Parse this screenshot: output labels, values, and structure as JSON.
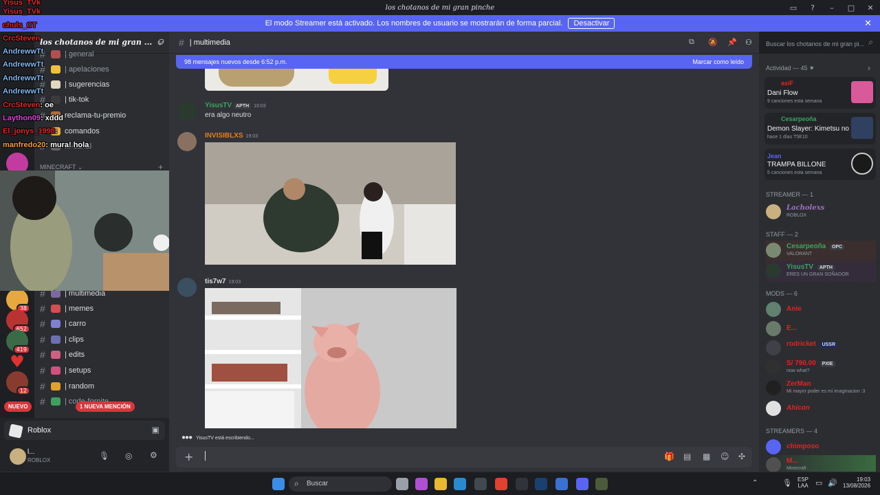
{
  "window": {
    "title": "los chotanos de mi gran pinche"
  },
  "banner": {
    "text": "El modo Streamer está activado. Los nombres de usuario se mostrarán de forma parcial.",
    "button": "Desactivar"
  },
  "server": {
    "name": "los chotanos de mi gran ...",
    "channels_top": [
      "| general",
      "| apelaciones",
      "| sugerencias",
      "| tik-tok",
      "reclama-tu-premio",
      "comandos",
      "...-canal"
    ],
    "category": "MINECRAFT",
    "channels_bottom": [
      "| multimedia",
      "| memes",
      "| carro",
      "| clips",
      "| edits",
      "| setups",
      "| random",
      "| code-fornite"
    ]
  },
  "guild_badges": [
    "38",
    "652",
    "419",
    "12"
  ],
  "pills": {
    "new": "NUEVO",
    "mention": "1 NUEVA MENCIÓN"
  },
  "overlay_chat": [
    {
      "user": "Yisus_TVk",
      "msg": ""
    },
    {
      "user": "Yisus_TVk",
      "msg": ""
    },
    {
      "user": "chuls_CT",
      "msg": ""
    },
    {
      "user": "CrcSteven",
      "msg": ""
    },
    {
      "user": "AndrewwTt",
      "msg": ""
    },
    {
      "user": "AndrewwTt",
      "msg": ""
    },
    {
      "user": "AndrewwTt",
      "msg": ""
    },
    {
      "user": "AndrewwTt",
      "msg": ""
    },
    {
      "user": "CrcSteven",
      "msg": ": oe"
    },
    {
      "user": "Laython09",
      "msg": ": xddd"
    },
    {
      "user": "El_jonys_1998",
      "msg": ":"
    },
    {
      "user": "manfredo20",
      "msg": ": mura! hola"
    }
  ],
  "user_panel": {
    "activity": "Roblox",
    "name": "l...",
    "status": "ROBLOX"
  },
  "channel": {
    "name": "| multimedia",
    "search_placeholder": "Buscar los chotanos de mi gran pi..."
  },
  "new_messages": {
    "text": "98 mensajes nuevos desde 6:52 p.m.",
    "action": "Marcar como leído"
  },
  "messages": [
    {
      "user": "YisusTV",
      "tag": "APTH",
      "time": "19:03",
      "text": "era algo neutro"
    },
    {
      "user": "INVISIBLXS",
      "time": "19:03"
    },
    {
      "user": "tis7w7",
      "time": "19:03"
    }
  ],
  "typing": "YisusTV está escribiendo...",
  "members": {
    "activity_header": "Actividad — 45",
    "activity": [
      {
        "user": "asiF",
        "title": "Dani Flow",
        "sub": "9 canciones esta semana"
      },
      {
        "user": "Cesarpeoña",
        "title": "Demon Slayer: Kimetsu no ...",
        "sub": "hace 1 días   T5E10"
      },
      {
        "user": "Jean",
        "title": "TRAMPA BILLONE",
        "sub": "5 canciones esta semana"
      }
    ],
    "sections": [
      "STREAMER — 1",
      "STAFF — 2",
      "MODS — 6",
      "STREAMERS — 4"
    ],
    "streamer": [
      {
        "name": "Lacholexs",
        "status": "ROBLOX"
      }
    ],
    "staff": [
      {
        "name": "Cesarpeoña",
        "tag": "OPC",
        "status": "VALORANT"
      },
      {
        "name": "YisusTV",
        "tag": "APTH",
        "status": "ERES UN GRAN SOÑADOR"
      }
    ],
    "mods": [
      {
        "name": "Anie",
        "status": ""
      },
      {
        "name": "E...",
        "status": ""
      },
      {
        "name": "rodricket",
        "tag": "USSR",
        "status": ""
      },
      {
        "name": "S/ 790.00",
        "tag": "PXIE",
        "status": "now what?"
      },
      {
        "name": "ZerMan",
        "status": "Mi mayor poder es mi imaginacion :3"
      },
      {
        "name": "Ahicon",
        "status": ""
      }
    ],
    "streamers": [
      {
        "name": "chimposo",
        "status": ""
      },
      {
        "name": "M...",
        "status": "Minecraft"
      }
    ]
  },
  "taskbar": {
    "search": "Buscar",
    "lang": "ESP",
    "lang2": "LAA",
    "time": "19:03",
    "date": "13/08/2026"
  }
}
